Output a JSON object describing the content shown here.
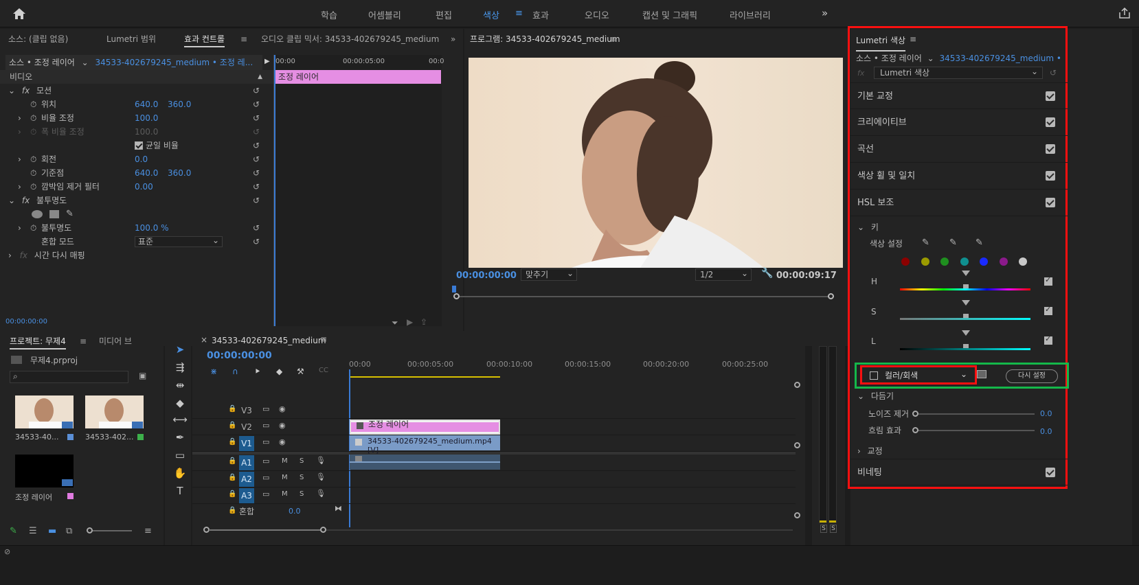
{
  "topnav": {
    "items": [
      "학습",
      "어셈블리",
      "편집",
      "색상",
      "효과",
      "오디오",
      "캡션 및 그래픽",
      "라이브러리"
    ],
    "active": "색상",
    "more": "»"
  },
  "effects_panel": {
    "tabs": [
      "소스: (클립 없음)",
      "Lumetri 범위",
      "효과 컨트롤",
      "오디오 클립 믹서: 34533-402679245_medium"
    ],
    "source_label": "소스 • 조정 레이어",
    "source_clip": "34533-402679245_medium • 조정 레...",
    "timecodes": [
      "00:00",
      "00:00:05:00",
      "00:0"
    ],
    "clip_label": "조정 레이어",
    "video_header": "비디오",
    "motion": "모션",
    "position": {
      "label": "위치",
      "x": "640.0",
      "y": "360.0"
    },
    "scale": {
      "label": "비율 조정",
      "value": "100.0"
    },
    "scale_width": {
      "label": "폭 비율 조정",
      "value": "100.0"
    },
    "uniform": "균일 비율",
    "rotation": {
      "label": "회전",
      "value": "0.0"
    },
    "anchor": {
      "label": "기준점",
      "x": "640.0",
      "y": "360.0"
    },
    "antiflicker": {
      "label": "깜박임 제거 필터",
      "value": "0.00"
    },
    "opacity_header": "불투명도",
    "opacity": {
      "label": "불투명도",
      "value": "100.0 %"
    },
    "blend": {
      "label": "혼합 모드",
      "value": "표준"
    },
    "time_remap": "시간 다시 매핑",
    "bottom_tc": "00:00:00:00"
  },
  "program": {
    "title": "프로그램: 34533-402679245_medium",
    "timecode": "00:00:00:00",
    "fit": "맞추기",
    "resolution": "1/2",
    "duration": "00:00:09:17"
  },
  "project": {
    "tab": "프로젝트: 무제4",
    "tab2": "미디어 브",
    "file": "무제4.prproj",
    "search_placeholder": "",
    "items": [
      {
        "name": "34533-40...",
        "color": "#5b8fd6"
      },
      {
        "name": "34533-402...",
        "color": "#3db04b"
      },
      {
        "name": "조정 레이어",
        "color": "#e07be0"
      }
    ]
  },
  "timeline": {
    "tab": "34533-402679245_medium",
    "timecode": "00:00:00:00",
    "ruler": [
      "00:00",
      "00:00:05:00",
      "00:00:10:00",
      "00:00:15:00",
      "00:00:20:00",
      "00:00:25:00"
    ],
    "tracks_video": [
      "V3",
      "V2",
      "V1"
    ],
    "tracks_audio": [
      "A1",
      "A2",
      "A3"
    ],
    "mix_label": "혼합",
    "mix_value": "0.0",
    "clip_adjust": "조정 레이어",
    "clip_video": "34533-402679245_medium.mp4 [V]",
    "toggles": {
      "m": "M",
      "s": "S"
    }
  },
  "meter": {
    "labels": [
      "S",
      "S"
    ]
  },
  "lumetri": {
    "title": "Lumetri 색상",
    "source": "소스 • 조정 레이어",
    "clip": "34533-402679245_medium • ...",
    "effect_select": "Lumetri 색상",
    "sections": [
      "기본 교정",
      "크리에이티브",
      "곡선",
      "색상 휠 및 일치",
      "HSL 보조"
    ],
    "key": "키",
    "color_set": "색상 설정",
    "swatches": [
      "#8b0000",
      "#9a9a00",
      "#1f8f1f",
      "#0f8f8f",
      "#1a2aff",
      "#8b1a8b",
      "#c8c8c8"
    ],
    "hsl": [
      "H",
      "S",
      "L"
    ],
    "mode": "컬러/회색",
    "reset": "다시 설정",
    "refine": "다듬기",
    "denoise": {
      "label": "노이즈 제거",
      "value": "0.0"
    },
    "blur": {
      "label": "흐림 효과",
      "value": "0.0"
    },
    "correction": "교정",
    "vignette": "비네팅"
  }
}
